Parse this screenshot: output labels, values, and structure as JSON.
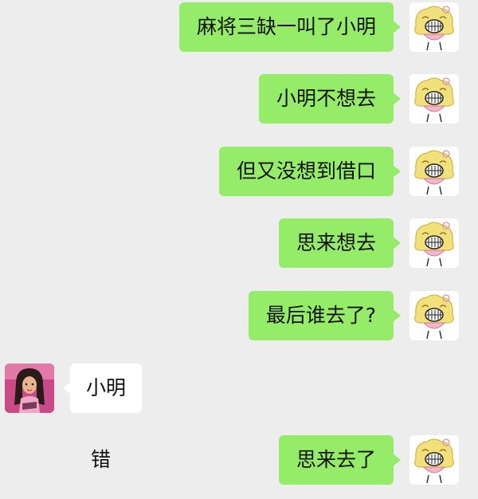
{
  "messages": [
    {
      "text": "麻将三缺一叫了小明"
    },
    {
      "text": "小明不想去"
    },
    {
      "text": "但又没想到借口"
    },
    {
      "text": "思来想去"
    },
    {
      "text": "最后谁去了?"
    },
    {
      "text": "小明"
    },
    {
      "text": "错"
    },
    {
      "text": "思来去了"
    }
  ],
  "colors": {
    "background": "#ededed",
    "sent_bubble": "#95ec69",
    "received_bubble": "#ffffff"
  },
  "icons": {
    "me_avatar": "cartoon-girl-avatar-icon",
    "other_avatar": "doll-avatar-icon"
  }
}
